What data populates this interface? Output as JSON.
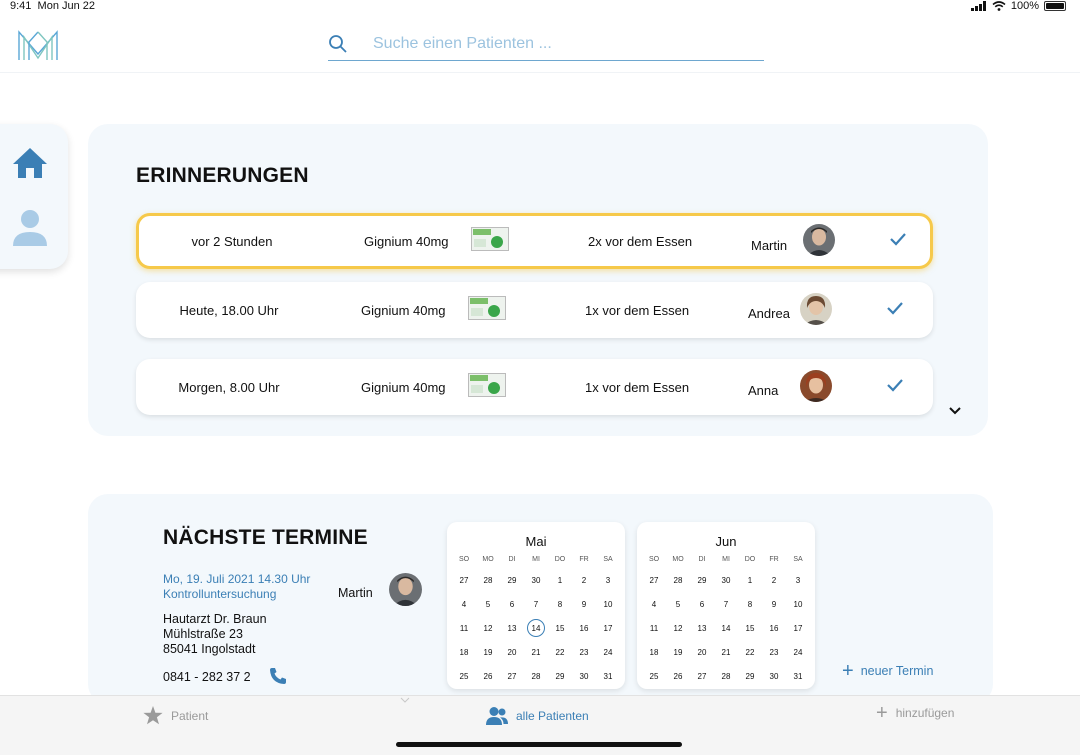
{
  "status": {
    "time": "9:41",
    "date": "Mon Jun 22",
    "battery": "100%",
    "battery_level": 1.0
  },
  "header": {
    "logo_icon": "m-logo",
    "search_placeholder": "Suche einen Patienten ..."
  },
  "sidebar": {
    "items": [
      {
        "icon": "home-icon"
      },
      {
        "icon": "person-icon"
      }
    ]
  },
  "reminders": {
    "title": "ERINNERUNGEN",
    "items": [
      {
        "time": "vor 2 Stunden",
        "medication": "Gignium 40mg",
        "dose": "2x vor dem Essen",
        "patient": "Martin",
        "urgent": true
      },
      {
        "time": "Heute, 18.00 Uhr",
        "medication": "Gignium 40mg",
        "dose": "1x vor dem Essen",
        "patient": "Andrea",
        "urgent": false
      },
      {
        "time": "Morgen, 8.00 Uhr",
        "medication": "Gignium 40mg",
        "dose": "1x vor dem Essen",
        "patient": "Anna",
        "urgent": false
      }
    ],
    "alert_glyph": "!"
  },
  "appointments": {
    "title": "NÄCHSTE TERMINE",
    "date": "Mo, 19. Juli 2021 14.30 Uhr",
    "kind": "Kontrolluntersuchung",
    "patient": "Martin",
    "address_line1": "Hautarzt Dr. Braun",
    "address_line2": "Mühlstraße 23",
    "address_line3": "85041 Ingolstadt",
    "phone": "0841 - 282 37 2",
    "new_label": "neuer Termin",
    "weekdays": [
      "SO",
      "MO",
      "DI",
      "MI",
      "DO",
      "FR",
      "SA"
    ],
    "calendars": [
      {
        "month": "Mai",
        "days": [
          "27",
          "28",
          "29",
          "30",
          "1",
          "2",
          "3",
          "4",
          "5",
          "6",
          "7",
          "8",
          "9",
          "10",
          "11",
          "12",
          "13",
          "14",
          "15",
          "16",
          "17",
          "18",
          "19",
          "20",
          "21",
          "22",
          "23",
          "24",
          "25",
          "26",
          "27",
          "28",
          "29",
          "30",
          "31"
        ],
        "today_index": 17
      },
      {
        "month": "Jun",
        "days": [
          "27",
          "28",
          "29",
          "30",
          "1",
          "2",
          "3",
          "4",
          "5",
          "6",
          "7",
          "8",
          "9",
          "10",
          "11",
          "12",
          "13",
          "14",
          "15",
          "16",
          "17",
          "18",
          "19",
          "20",
          "21",
          "22",
          "23",
          "24",
          "25",
          "26",
          "27",
          "28",
          "29",
          "30",
          "31"
        ],
        "today_index": -1
      }
    ]
  },
  "tabbar": {
    "patient": "Patient",
    "all_patients": "alle Patienten",
    "add": "hinzufügen"
  },
  "colors": {
    "accent": "#3b7fb5",
    "panel": "#f3f8fc",
    "highlight": "#f6c94a"
  }
}
